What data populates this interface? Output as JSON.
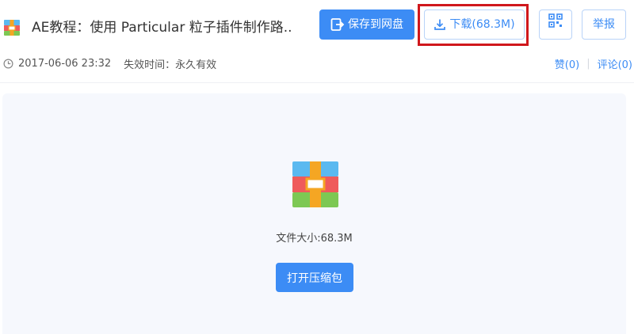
{
  "header": {
    "file_title": "AE教程：使用 Particular 粒子插件制作路..",
    "save_button_label": "保存到网盘",
    "download_button_label": "下载(68.3M)",
    "report_button_label": "举报",
    "file_icon": "archive-icon"
  },
  "meta": {
    "date": "2017-06-06 23:32",
    "expire": "失效时间：永久有效"
  },
  "actions": {
    "like": "赞(0)",
    "comment": "评论(0)"
  },
  "panel": {
    "size_text": "文件大小:68.3M",
    "open_button_label": "打开压缩包"
  },
  "colors": {
    "primary": "#3c8cf5",
    "highlight": "#d0171c"
  }
}
